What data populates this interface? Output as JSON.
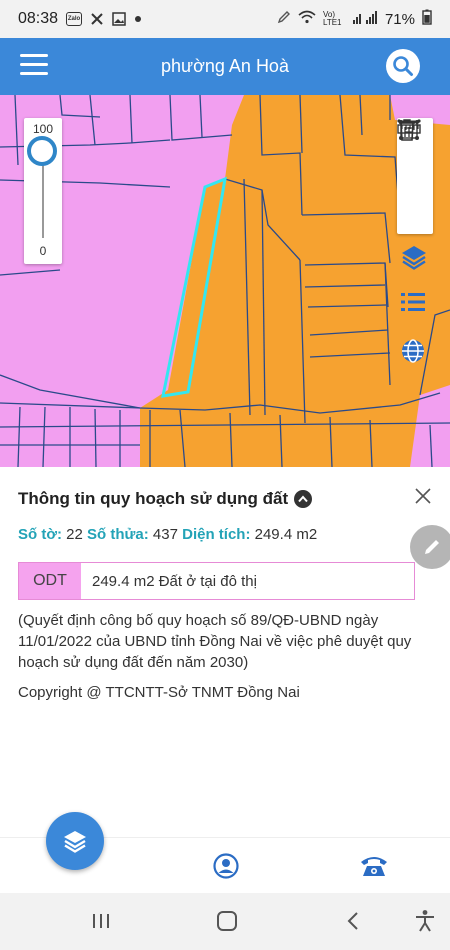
{
  "status_bar": {
    "time": "08:38",
    "zalo_label": "Zalo",
    "network_label": "Vo) LTE1",
    "battery": "71%"
  },
  "app_bar": {
    "title": "phường An Hoà"
  },
  "map": {
    "opacity_max": "100",
    "opacity_min": "0",
    "opacity_value": 100,
    "colors": {
      "residential": "#f29ff0",
      "planned": "#f6a230",
      "parcel_line": "#2a4a8a",
      "selection": "#34e6f0"
    }
  },
  "info": {
    "title": "Thông tin quy hoạch sử dụng đất",
    "so_to_label": "Số tờ:",
    "so_to_value": "22",
    "so_thua_label": "Số thửa:",
    "so_thua_value": "437",
    "dien_tich_label": "Diện tích:",
    "dien_tich_value": "249.4 m2",
    "landuse_code": "ODT",
    "landuse_desc": "249.4 m2 Đất ở tại đô thị",
    "decision": "(Quyết định công bố quy hoạch số 89/QĐ-UBND ngày 11/01/2022 của UBND tỉnh Đồng Nai về việc phê duyệt quy hoạch sử dụng đất đến năm 2030)",
    "copyright": "Copyright @ TTCNTT-Sở TNMT Đồng Nai"
  },
  "icons": {
    "menu": "menu-icon",
    "search": "search-icon",
    "measure_length": "ruler-icon",
    "measure_area": "area-measure-icon",
    "delete": "trash-icon",
    "layers": "layers-icon",
    "list": "list-icon",
    "globe": "globe-icon",
    "edit": "pencil-icon",
    "user": "user-icon",
    "phone": "phone-icon"
  }
}
